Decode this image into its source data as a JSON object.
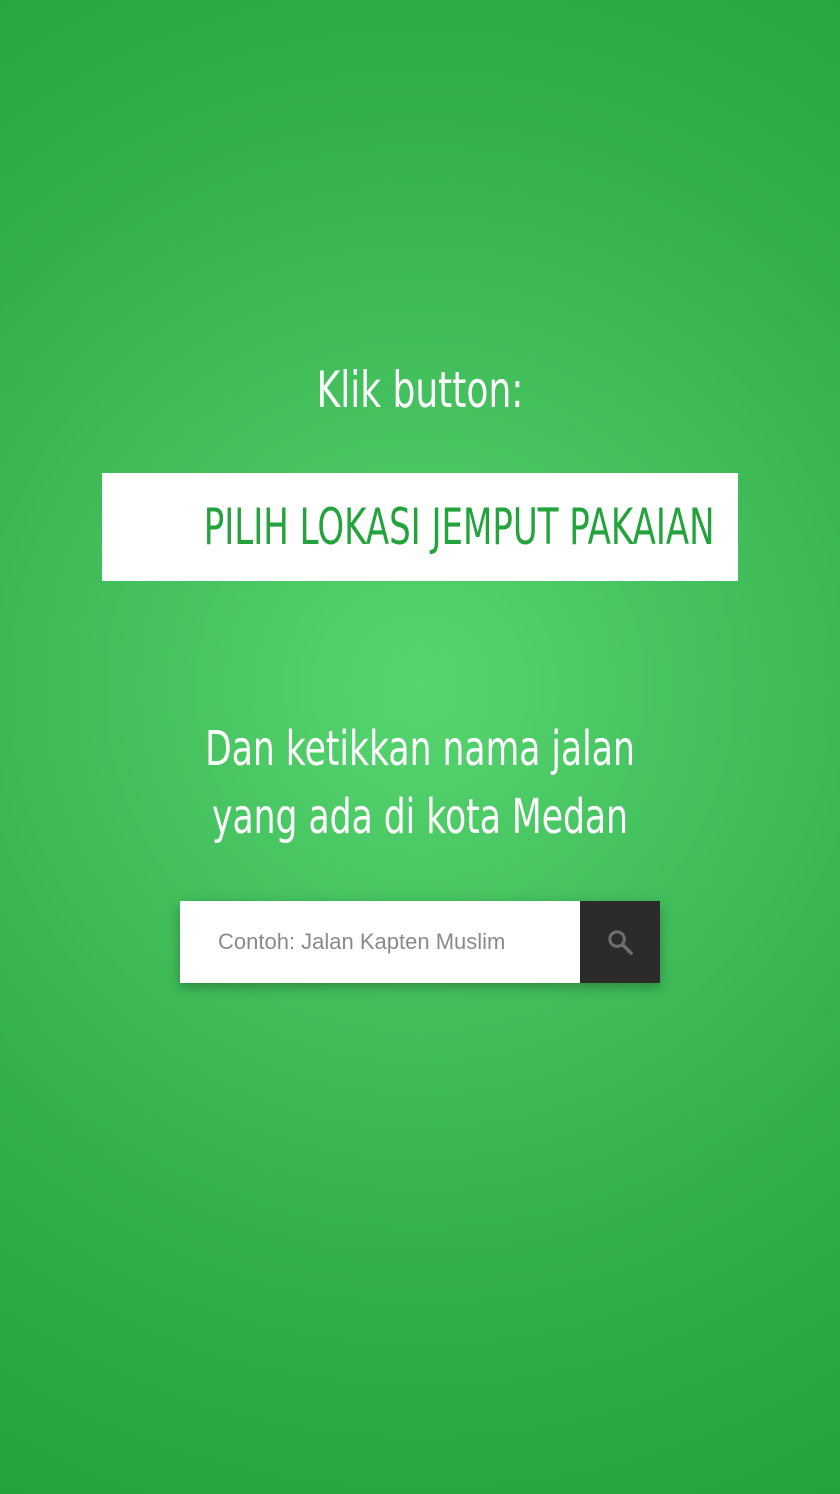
{
  "instruction": {
    "intro": "Klik button:",
    "button_label": "PILIH LOKASI JEMPUT PAKAIAN",
    "line1": "Dan ketikkan nama jalan",
    "line2": "yang ada di kota Medan"
  },
  "search": {
    "placeholder": "Contoh: Jalan Kapten Muslim",
    "value": "",
    "button_icon": "search-icon"
  },
  "colors": {
    "accent": "#22a33b",
    "background_center": "#55d56f",
    "background_edge": "#22a33b",
    "search_button": "#2b2b2b"
  }
}
